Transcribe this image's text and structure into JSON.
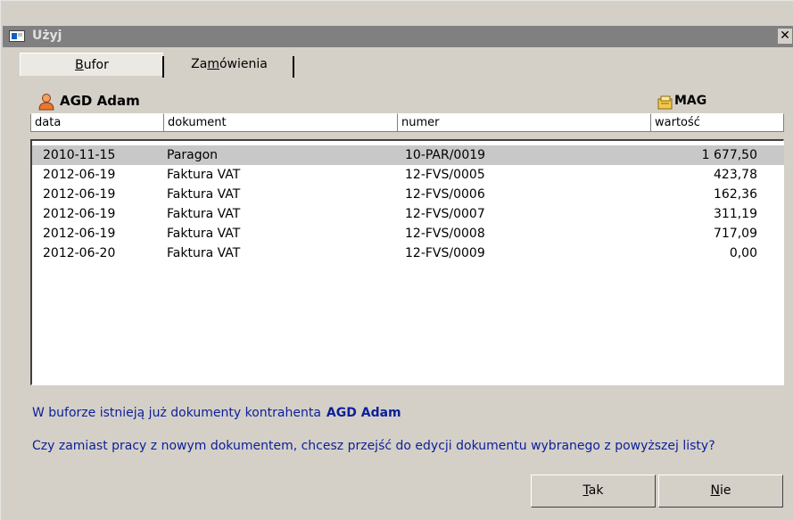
{
  "window": {
    "title": "Użyj",
    "close_label": "✕"
  },
  "tabs": [
    {
      "pre": "",
      "ul": "B",
      "post": "ufor"
    },
    {
      "pre": "Za",
      "ul": "m",
      "post": "ówienia"
    }
  ],
  "contractor": {
    "name": "AGD Adam",
    "store": "MAG"
  },
  "columns": {
    "data": "data",
    "dokument": "dokument",
    "numer": "numer",
    "wartosc": "wartość"
  },
  "rows": [
    {
      "data": "2010-11-15",
      "dokument": "Paragon",
      "numer": "10-PAR/0019",
      "wartosc": "1 677,50"
    },
    {
      "data": "2012-06-19",
      "dokument": "Faktura VAT",
      "numer": "12-FVS/0005",
      "wartosc": "423,78"
    },
    {
      "data": "2012-06-19",
      "dokument": "Faktura VAT",
      "numer": "12-FVS/0006",
      "wartosc": "162,36"
    },
    {
      "data": "2012-06-19",
      "dokument": "Faktura VAT",
      "numer": "12-FVS/0007",
      "wartosc": "311,19"
    },
    {
      "data": "2012-06-19",
      "dokument": "Faktura VAT",
      "numer": "12-FVS/0008",
      "wartosc": "717,09"
    },
    {
      "data": "2012-06-20",
      "dokument": "Faktura VAT",
      "numer": "12-FVS/0009",
      "wartosc": "0,00"
    }
  ],
  "messages": {
    "line1": "W buforze istnieją już dokumenty kontrahenta",
    "line1_name": "AGD Adam",
    "line2": "Czy zamiast pracy z nowym dokumentem, chcesz przejść do edycji dokumentu wybranego z powyższej listy?"
  },
  "buttons": {
    "yes": {
      "ul": "T",
      "post": "ak"
    },
    "no": {
      "ul": "N",
      "post": "ie"
    }
  },
  "colors": {
    "message_text": "#0b1f9a",
    "selected_row": "#c8c8c8",
    "titlebar": "#808080",
    "dialog_bg": "#d4d0c8"
  }
}
